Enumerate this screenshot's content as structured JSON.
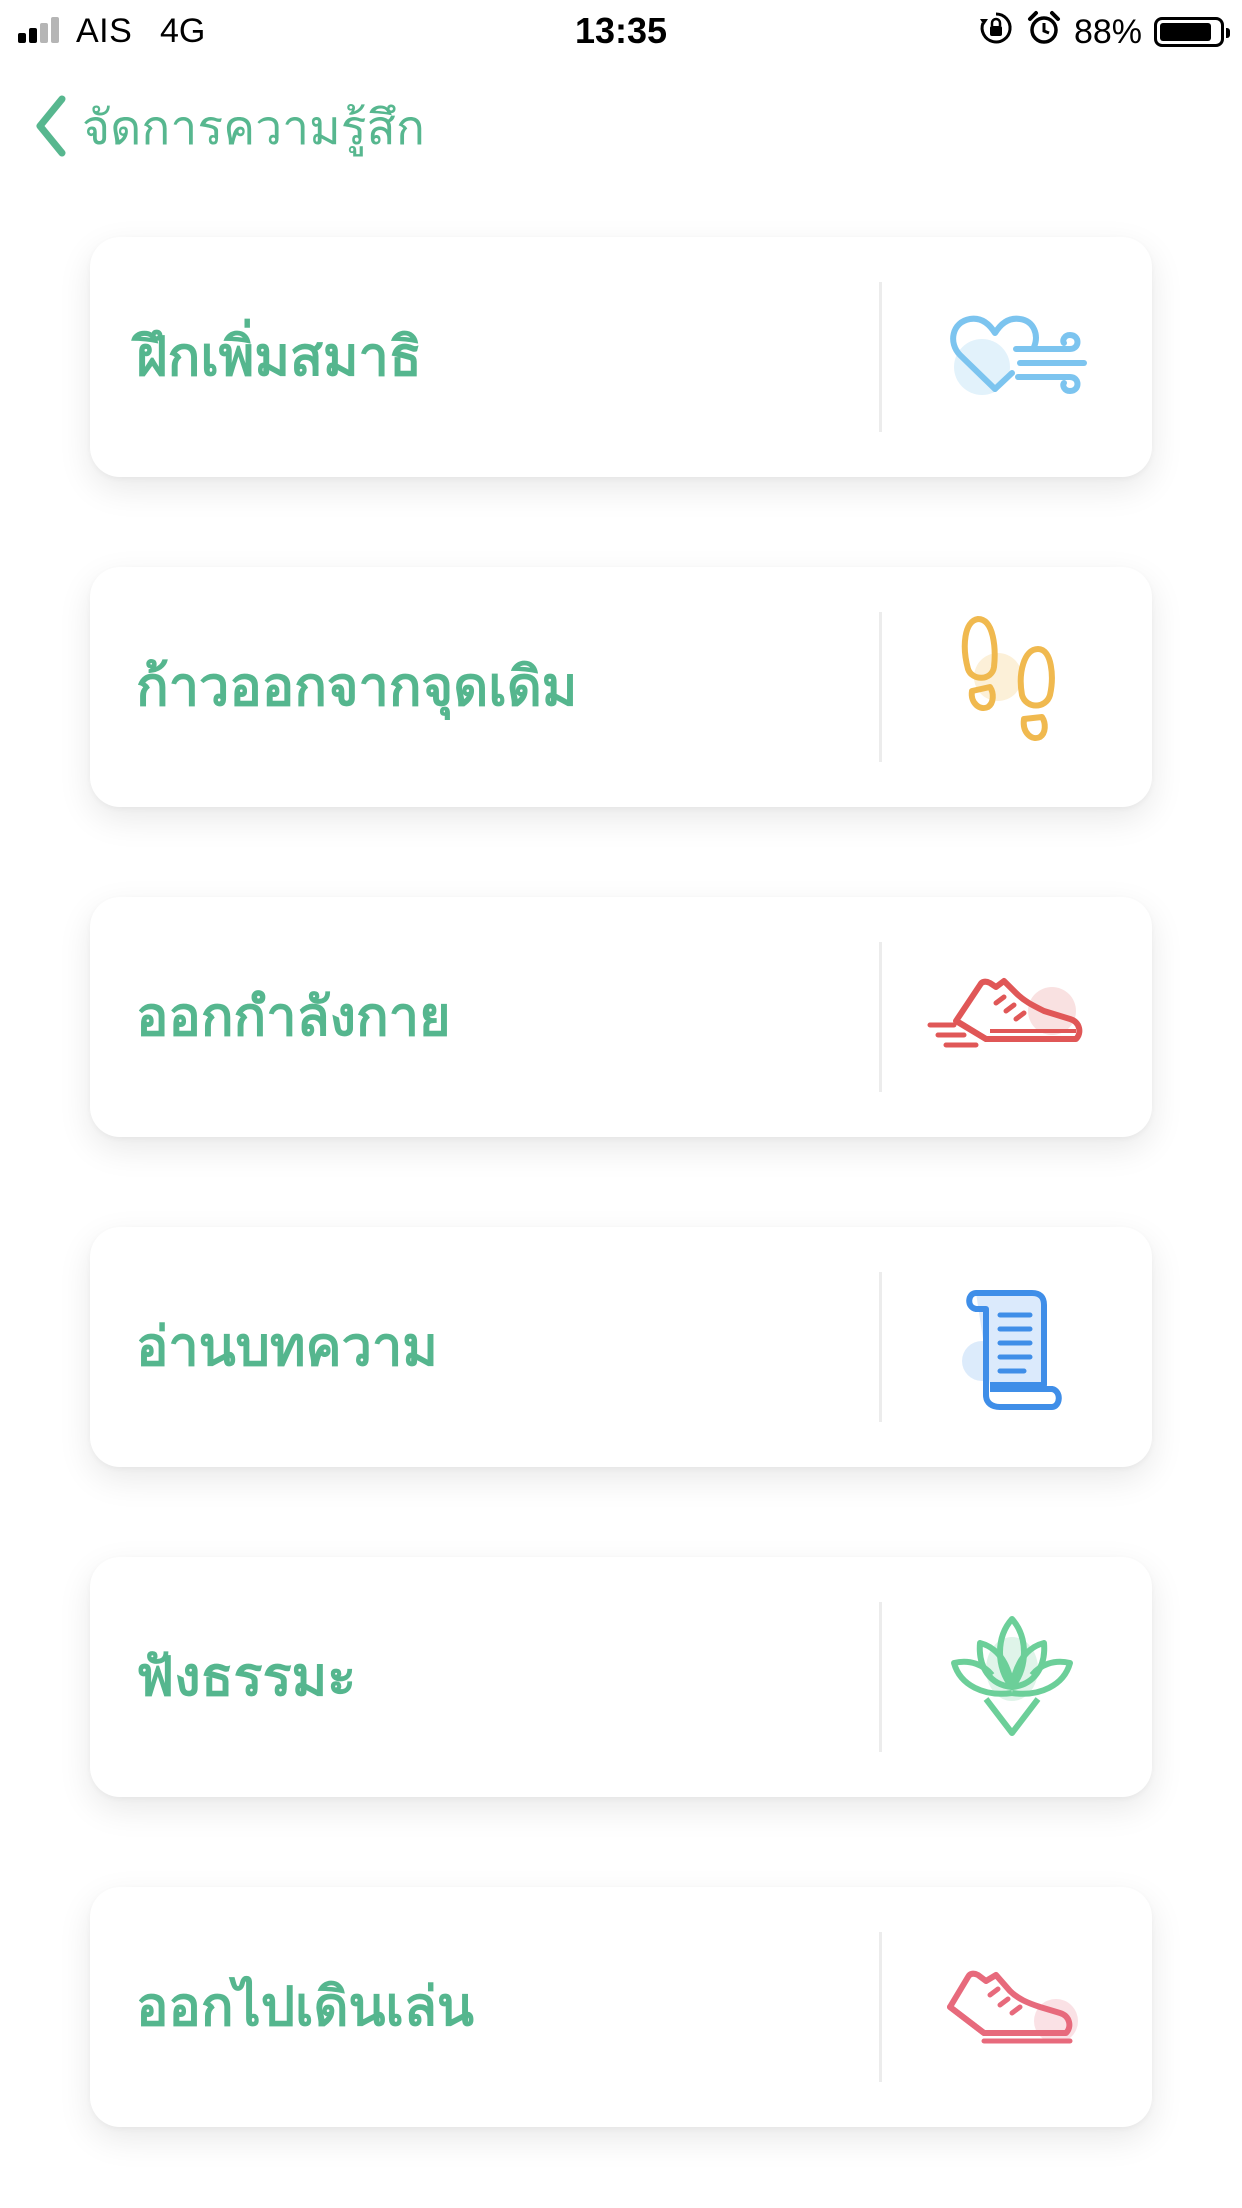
{
  "status_bar": {
    "carrier": "AIS",
    "network": "4G",
    "time": "13:35",
    "battery_percent": "88%",
    "battery_level": 0.88,
    "icons": [
      "signal-icon",
      "orientation-lock-icon",
      "alarm-icon",
      "battery-icon"
    ]
  },
  "nav": {
    "back_icon": "chevron-left-icon",
    "title": "จัดการความรู้สึก"
  },
  "colors": {
    "accent": "#57b78f",
    "meditation": "#7cc4ef",
    "steps": "#f0b94f",
    "exercise": "#e05757",
    "article": "#3f8ee8",
    "dharma": "#6ccf99",
    "walk": "#e76a7c"
  },
  "menu": {
    "items": [
      {
        "label": "ฝึกเพิ่มสมาธิ",
        "icon": "heart-breath-icon"
      },
      {
        "label": "ก้าวออกจากจุดเดิม",
        "icon": "footsteps-icon"
      },
      {
        "label": "ออกกำลังกาย",
        "icon": "running-shoe-icon"
      },
      {
        "label": "อ่านบทความ",
        "icon": "scroll-icon"
      },
      {
        "label": "ฟังธรรมะ",
        "icon": "lotus-icon"
      },
      {
        "label": "ออกไปเดินเล่น",
        "icon": "sneaker-icon"
      }
    ]
  }
}
